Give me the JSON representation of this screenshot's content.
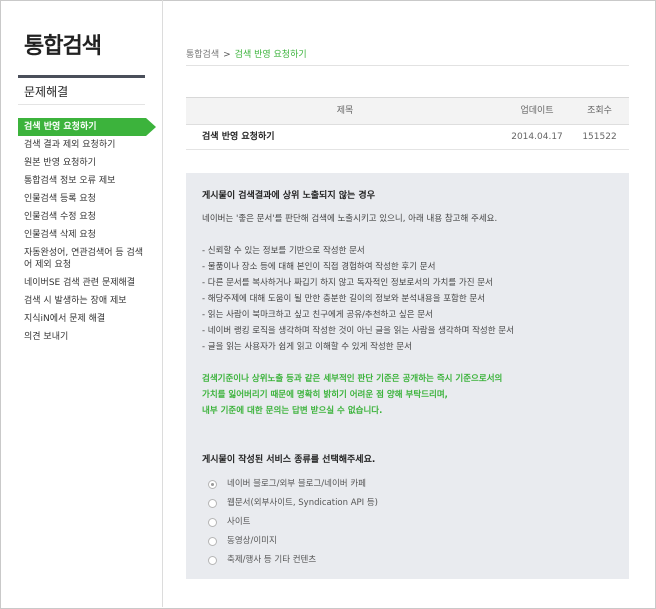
{
  "sidebar": {
    "logo": "통합검색",
    "section_title": "문제해결",
    "menu": [
      {
        "label": "검색 반영 요청하기",
        "active": true
      },
      {
        "label": "검색 결과 제외 요청하기"
      },
      {
        "label": "원본 반영 요청하기"
      },
      {
        "label": "통합검색 정보 오류 제보"
      },
      {
        "label": "인물검색 등록 요청"
      },
      {
        "label": "인물검색 수정 요청"
      },
      {
        "label": "인물검색 삭제 요청"
      },
      {
        "label": "자동완성어, 연관검색어 등 검색어 제외 요청"
      },
      {
        "label": "네이버SE 검색 관련 문제해결"
      },
      {
        "label": "검색 시 발생하는 장애 제보"
      },
      {
        "label": "지식iN에서 문제 해결"
      },
      {
        "label": "의견 보내기"
      }
    ]
  },
  "breadcrumb": {
    "root": "통합검색",
    "separator": ">",
    "current": "검색 반영 요청하기"
  },
  "table": {
    "headers": {
      "title": "제목",
      "updated": "업데이트",
      "views": "조회수"
    },
    "rows": [
      {
        "title": "검색 반영 요청하기",
        "updated": "2014.04.17",
        "views": "151522"
      }
    ]
  },
  "content": {
    "heading": "게시물이 검색결과에 상위 노출되지 않는 경우",
    "intro": "네이버는 '좋은 문서'를 판단해 검색에 노출시키고 있으니, 아래 내용 참고해 주세요.",
    "list": [
      "- 신뢰할 수 있는 정보를 기반으로 작성한 문서",
      "- 물품이나 장소 등에 대해 본인이 직접 경험하여 작성한 후기 문서",
      "- 다른 문서를 복사하거나 짜깁기 하지 않고 독자적인 정보로서의 가치를 가진 문서",
      "- 해당주제에 대해 도움이 될 만한 충분한 길이의 정보와 분석내용을 포함한 문서",
      "- 읽는 사람이 북마크하고 싶고 친구에게 공유/추천하고 싶은 문서",
      "- 네이버 랭킹 로직을 생각하며 작성한 것이 아닌 글을 읽는 사람을 생각하며 작성한 문서",
      "- 글을 읽는 사용자가 쉽게 읽고 이해할 수 있게 작성한 문서"
    ],
    "notice": [
      "검색기준이나 상위노출 등과 같은 세부적인 판단 기준은 공개하는 즉시 기준으로서의",
      "가치를 잃어버리기 때문에 명확히 밝히기 어려운 점 양해 부탁드리며,",
      "내부 기준에 대한 문의는 답변 받으실 수 없습니다."
    ],
    "question": "게시물이 작성된 서비스 종류를 선택해주세요.",
    "options": [
      {
        "label": "네이버 블로그/외부 블로그/네이버 카페",
        "checked": true
      },
      {
        "label": "웹문서(외부사이트, Syndication API 등)"
      },
      {
        "label": "사이트"
      },
      {
        "label": "동영상/이미지"
      },
      {
        "label": "축제/행사 등 기타 컨텐츠"
      }
    ]
  },
  "colors": {
    "accent": "#3cb33c",
    "panel": "#e9ebef"
  }
}
